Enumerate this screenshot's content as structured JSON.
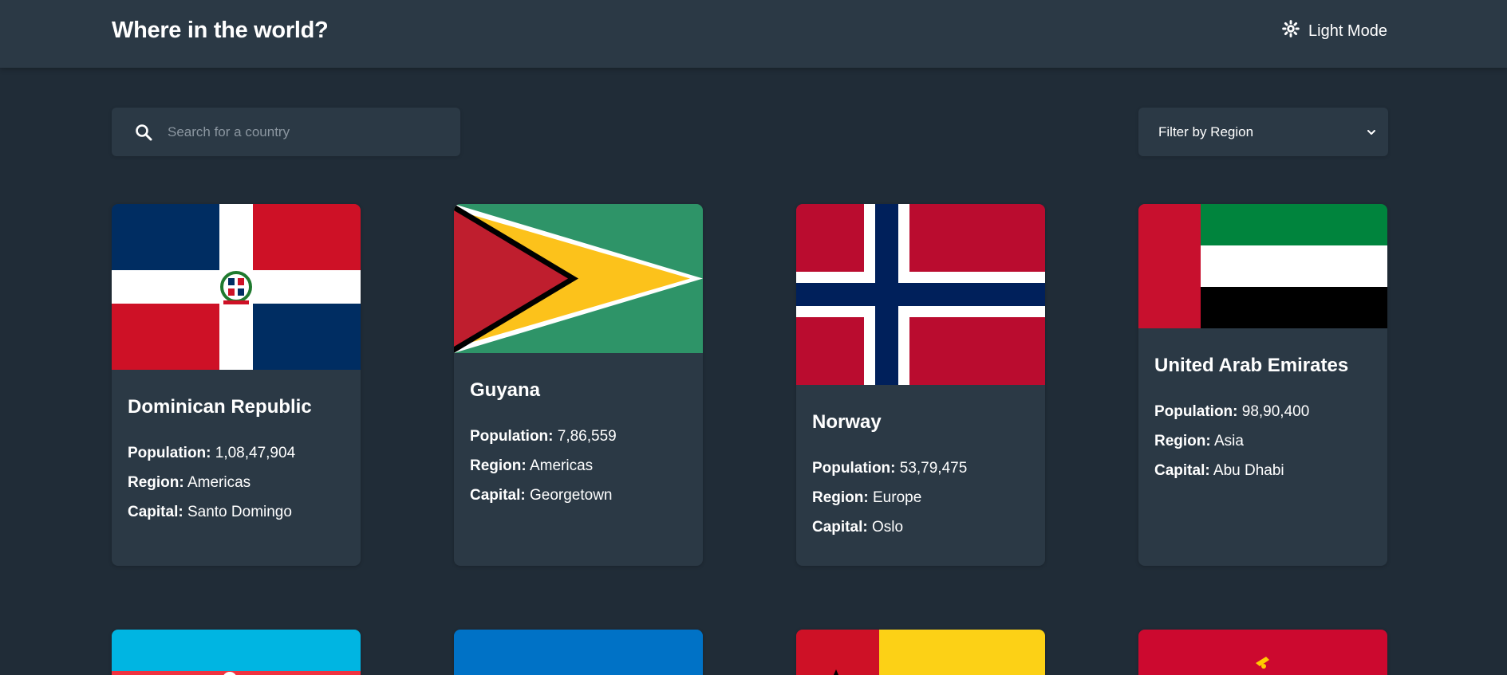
{
  "header": {
    "title": "Where in the world?",
    "mode_label": "Light Mode",
    "mode_icon": "sun-icon"
  },
  "search": {
    "placeholder": "Search for a country",
    "icon": "search-icon"
  },
  "filter": {
    "label": "Filter by Region",
    "icon": "chevron-down-icon"
  },
  "labels": {
    "population": "Population:",
    "region": "Region:",
    "capital": "Capital:"
  },
  "countries": [
    {
      "name": "Dominican Republic",
      "population": "1,08,47,904",
      "region": "Americas",
      "capital": "Santo Domingo"
    },
    {
      "name": "Guyana",
      "population": "7,86,559",
      "region": "Americas",
      "capital": "Georgetown"
    },
    {
      "name": "Norway",
      "population": "53,79,475",
      "region": "Europe",
      "capital": "Oslo"
    },
    {
      "name": "United Arab Emirates",
      "population": "98,90,400",
      "region": "Asia",
      "capital": "Abu Dhabi"
    }
  ],
  "colors": {
    "background": "#202c37",
    "elements": "#2b3945",
    "text": "#ffffff"
  }
}
